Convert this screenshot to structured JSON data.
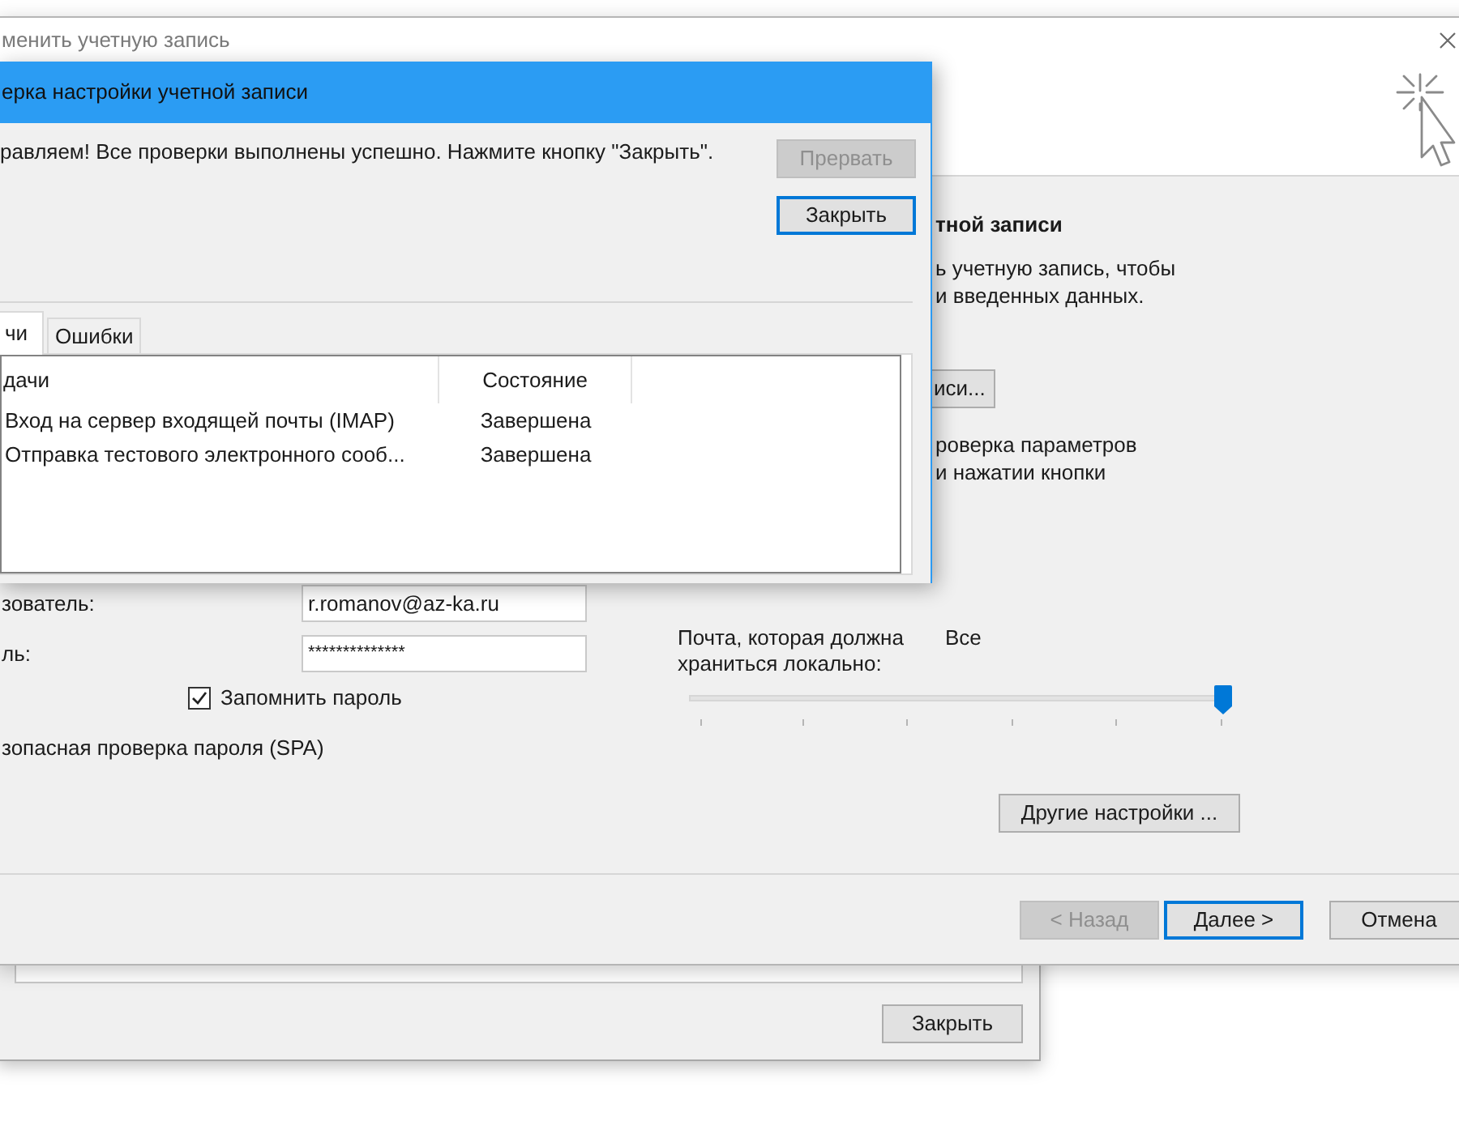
{
  "back_window": {
    "close_button": "Закрыть"
  },
  "wizard_window": {
    "title": "менить учетную запись",
    "section_heading": "тной записи",
    "description_lines": [
      "ь учетную запись, чтобы",
      "и введенных данных."
    ],
    "test_button": "иси...",
    "auto_test_lines": [
      "роверка параметров",
      "и нажатии кнопки"
    ],
    "user_label": "зователь:",
    "user_value": "r.romanov@az-ka.ru",
    "password_label": "ль:",
    "password_value": "**************",
    "remember_password": {
      "label": "Запомнить пароль",
      "checked": true
    },
    "spa_label": "зопасная проверка пароля (SPA)",
    "offline_mail": {
      "label_lines": [
        "Почта, которая должна",
        "храниться локально:"
      ],
      "value": "Все",
      "level": 1
    },
    "more_settings_button": "Другие настройки ...",
    "footer_buttons": [
      {
        "label": "< Назад",
        "disabled": true,
        "default": false
      },
      {
        "label": "Далее >",
        "disabled": false,
        "default": true
      },
      {
        "label": "Отмена",
        "disabled": false,
        "default": false
      }
    ]
  },
  "test_dialog": {
    "title": "ерка настройки учетной записи",
    "message": "равляем! Все проверки выполнены успешно. Нажмите кнопку \"Закрыть\".",
    "buttons": [
      {
        "label": "Прервать",
        "disabled": true,
        "default": false
      },
      {
        "label": "Закрыть",
        "disabled": false,
        "default": true
      }
    ],
    "tabs": [
      {
        "label": "чи",
        "selected": true
      },
      {
        "label": "Ошибки",
        "selected": false
      }
    ],
    "table": {
      "columns": [
        "дачи",
        "Состояние"
      ],
      "rows": [
        [
          "Вход на сервер входящей почты (IMAP)",
          "Завершена"
        ],
        [
          "Отправка тестового электронного сооб...",
          "Завершена"
        ]
      ]
    }
  }
}
